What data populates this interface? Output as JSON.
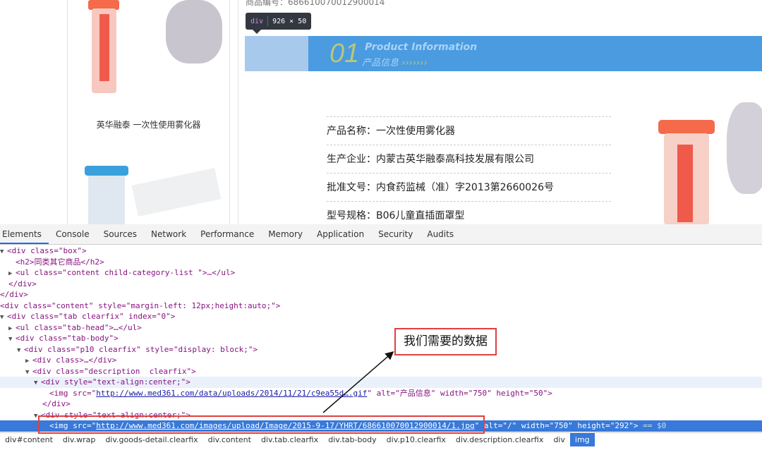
{
  "page": {
    "product_code": "商品编号：686610070012900014",
    "side_caption": "英华融泰 一次性使用雾化器",
    "tooltip": {
      "tag": "div",
      "size": "926 × 50"
    },
    "banner": {
      "number": "01",
      "title_en": "Product Information",
      "title_zh": "产品信息",
      "chevrons": "›››››››"
    },
    "info": [
      "产品名称：一次性使用雾化器",
      "生产企业：内蒙古英华融泰高科技发展有限公司",
      "批准文号：内食药监械（准）字2013第2660026号",
      "型号规格：B06儿童直插面罩型"
    ]
  },
  "devtools": {
    "tabs": [
      "Elements",
      "Console",
      "Sources",
      "Network",
      "Performance",
      "Memory",
      "Application",
      "Security",
      "Audits"
    ],
    "active_tab": "Elements",
    "breadcrumbs": [
      "div#content",
      "div.wrap",
      "div.goods-detail.clearfix",
      "div.content",
      "div.tab.clearfix",
      "div.tab-body",
      "div.p10.clearfix",
      "div.description.clearfix",
      "div",
      "img"
    ],
    "tree": {
      "l0": "<div class=\"box\">",
      "l1": "<h2>同类其它商品</h2>",
      "l2": "<ul class=\"content child-category-list \">…</ul>",
      "l3": "</div>",
      "l4": "</div>",
      "l5": "<div class=\"content\" style=\"margin-left: 12px;height:auto;\">",
      "l6": "<div class=\"tab clearfix\" index=\"0\">",
      "l7": "<ul class=\"tab-head\">…</ul>",
      "l8": "<div class=\"tab-body\">",
      "l9": "<div class=\"p10 clearfix\" style=\"display: block;\">",
      "l10": "<div class>…</div>",
      "l11": "<div class=\"description  clearfix\">",
      "l12": "<div style=\"text-align:center;\">",
      "l13_pre": "<img src=\"",
      "l13_url": "http://www.med361.com/data/uploads/2014/11/21/c9ea55d….gif",
      "l13_post": "\" alt=\"产品信息\" width=\"750\" height=\"50\">",
      "l14": "</div>",
      "l15": "<div style=\"text-align:center;\">",
      "l16_pre": "<img src=\"",
      "l16_url": "http://www.med361.com/images/upload/Image/2015-9-17/YHRT/686610070012900014/1.jpg",
      "l16_post": "\" alt=\"/\" width=\"750\" height=\"292\">",
      "l16_eq": " == $0"
    }
  },
  "annotation": {
    "text": "我们需要的数据",
    "color": "#e04040"
  }
}
